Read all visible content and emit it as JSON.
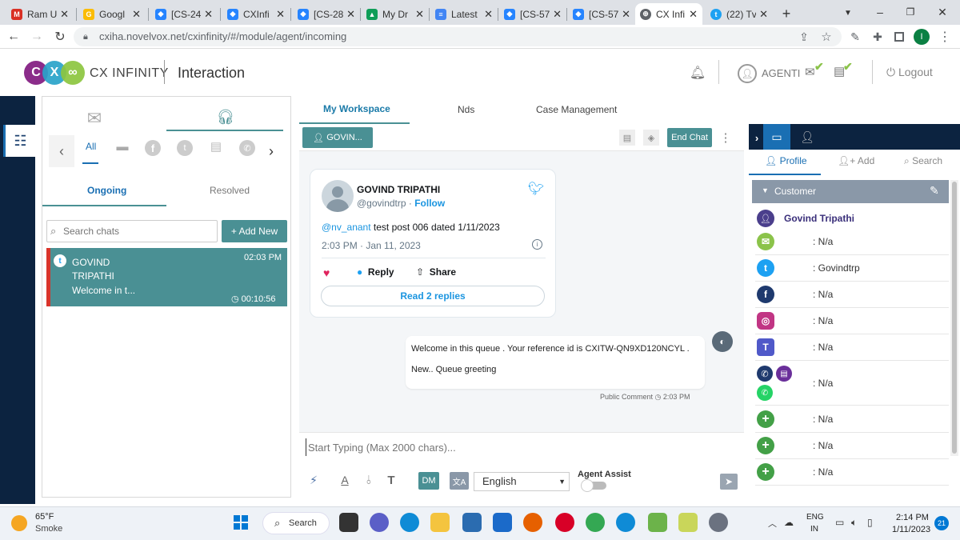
{
  "browser": {
    "tabs": [
      {
        "title": "Ram U",
        "favicon": "gmail-icon",
        "color": "#d93025"
      },
      {
        "title": "Googl",
        "favicon": "google-icon",
        "color": "#fbbc04"
      },
      {
        "title": "[CS-24",
        "favicon": "jira-icon",
        "color": "#2684ff"
      },
      {
        "title": "CXInfi",
        "favicon": "jira-icon",
        "color": "#2684ff"
      },
      {
        "title": "[CS-28",
        "favicon": "jira-icon",
        "color": "#2684ff"
      },
      {
        "title": "My Dr",
        "favicon": "drive-icon",
        "color": "#0f9d58"
      },
      {
        "title": "Latest",
        "favicon": "docs-icon",
        "color": "#4285f4"
      },
      {
        "title": "[CS-57",
        "favicon": "jira-icon",
        "color": "#2684ff"
      },
      {
        "title": "[CS-57",
        "favicon": "jira-icon",
        "color": "#2684ff"
      },
      {
        "title": "CX Infi",
        "favicon": "globe-icon",
        "color": "#5f6368"
      },
      {
        "title": "(22) Tv",
        "favicon": "twitter-icon",
        "color": "#1da1f2"
      }
    ],
    "url": "cxiha.novelvox.net/cxinfinity/#/module/agent/incoming",
    "profile_initial": "I"
  },
  "app": {
    "logo_text": "CX INFINITY",
    "logo_letters": [
      "C",
      "X"
    ],
    "title": "Interaction",
    "agent_name": "AGENTI",
    "logout": "Logout"
  },
  "left": {
    "filters": [
      "All"
    ],
    "tabs": [
      "Ongoing",
      "Resolved"
    ],
    "search_placeholder": "Search chats",
    "add_new": "+ Add New",
    "chat": {
      "name_line1": "GOVIND",
      "name_line2": "TRIPATHI",
      "preview": "Welcome in t...",
      "time": "02:03 PM",
      "duration": "00:10:56"
    }
  },
  "center": {
    "tabs": [
      "My Workspace",
      "Nds",
      "Case Management"
    ],
    "contact_chip": "GOVIN...",
    "end_chat": "End Chat",
    "tweet": {
      "name": "GOVIND TRIPATHI",
      "handle": "@govindtrp",
      "follow": "Follow",
      "mention": "@nv_anant",
      "text": " test post 006 dated 1/11/2023",
      "time": "2:03 PM · Jan 11, 2023",
      "reply": "Reply",
      "share": "Share",
      "read_replies": "Read 2 replies",
      "separator": " · "
    },
    "agent_msg": {
      "line1": "Welcome in this queue . Your reference id is CXITW-QN9XD120NCYL .",
      "line2": "New.. Queue greeting",
      "meta": "Public Comment",
      "time": "2:03 PM"
    },
    "composer_placeholder": "Start Typing (Max 2000 chars)...",
    "dm": "DM",
    "language": "English",
    "agent_assist": "Agent Assist"
  },
  "right": {
    "tabs": [
      "Profile",
      "Add",
      "Search"
    ],
    "section": "Customer",
    "customer_name": "Govind Tripathi",
    "rows": [
      {
        "icon": "email-icon",
        "value": ": N/a",
        "color": "#8bc34a"
      },
      {
        "icon": "twitter-icon",
        "value": ": Govindtrp",
        "color": "#1da1f2"
      },
      {
        "icon": "facebook-icon",
        "value": ": N/a",
        "color": "#1f3a6e"
      },
      {
        "icon": "instagram-icon",
        "value": ": N/a",
        "color": "#c13584"
      },
      {
        "icon": "teams-icon",
        "value": ": N/a",
        "color": "#5059c9"
      },
      {
        "icon": "phone-whatsapp-icon",
        "value": ": N/a",
        "color": "#25d366"
      },
      {
        "icon": "add-icon",
        "value": ": N/a",
        "color": "#43a047"
      },
      {
        "icon": "add-icon",
        "value": ": N/a",
        "color": "#43a047"
      },
      {
        "icon": "add-icon",
        "value": ": N/a",
        "color": "#43a047"
      }
    ]
  },
  "taskbar": {
    "weather_temp": "65°F",
    "weather_desc": "Smoke",
    "search": "Search",
    "lang1": "ENG",
    "lang2": "IN",
    "time": "2:14 PM",
    "date": "1/11/2023",
    "notif_count": "21"
  },
  "colors": {
    "teal": "#4a9094",
    "navy": "#0c2340",
    "accent": "#1a6fb3",
    "tab_blue": "#1a7aa8"
  }
}
